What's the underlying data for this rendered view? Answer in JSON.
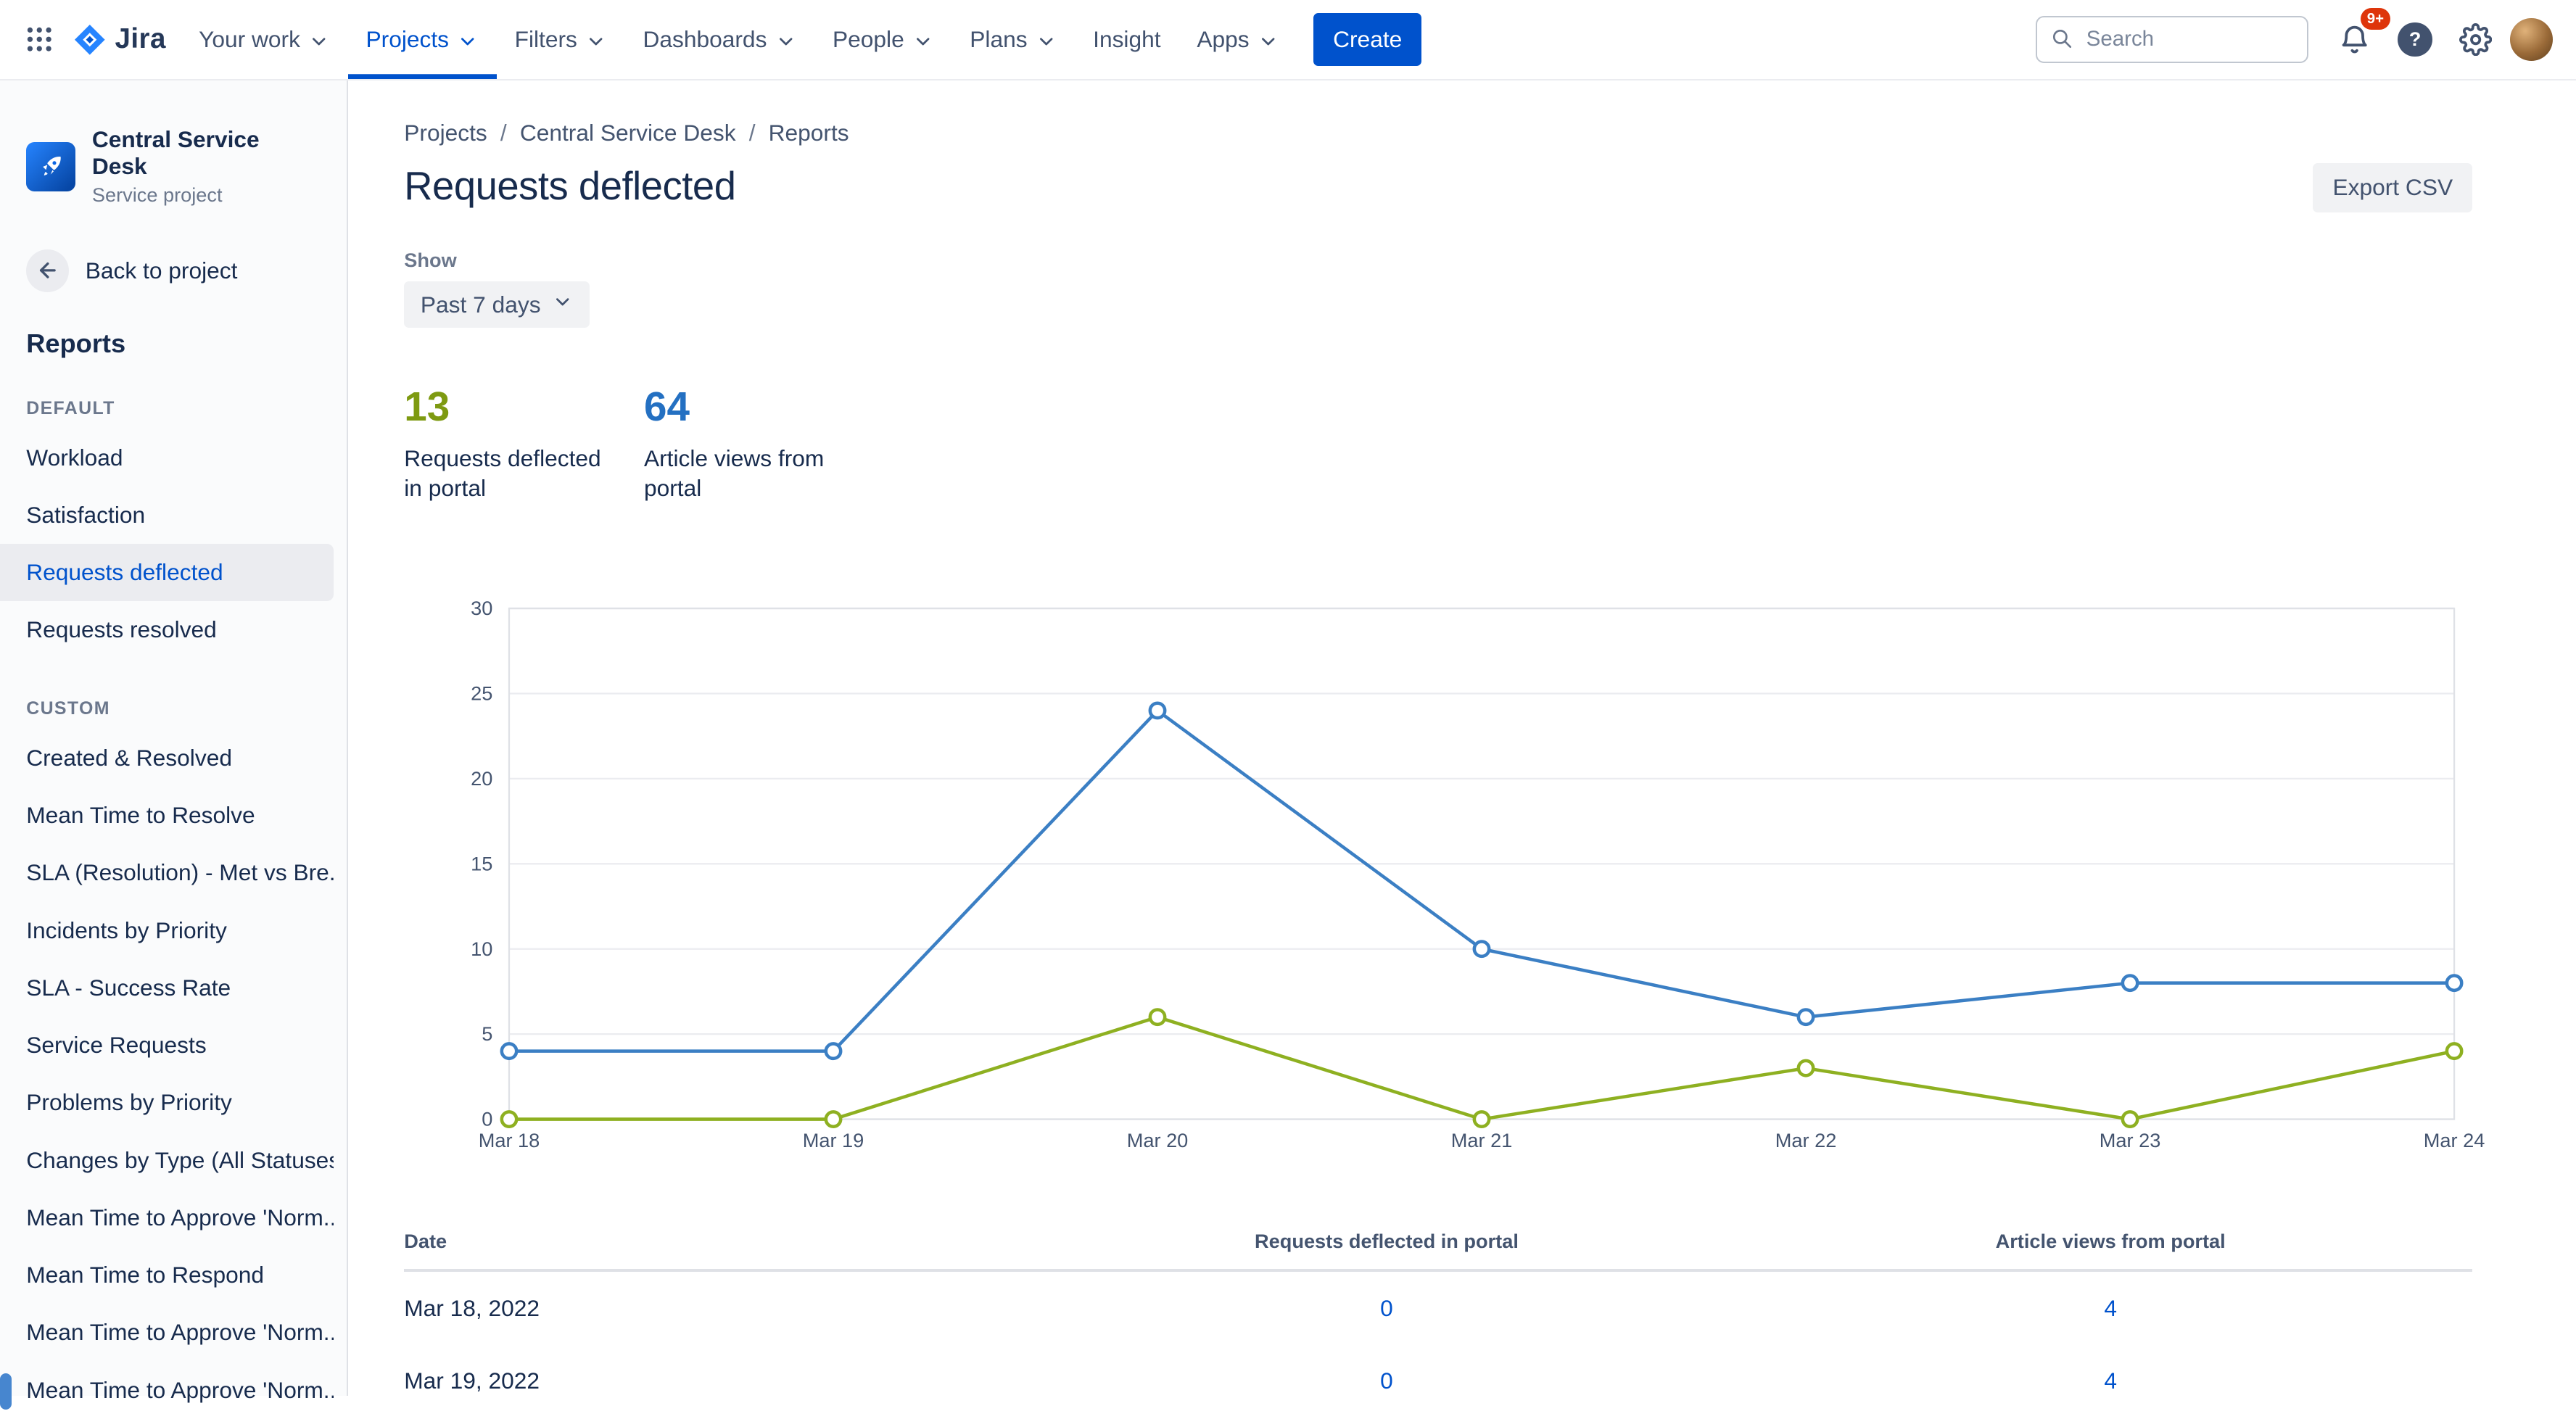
{
  "colors": {
    "accent": "#0052CC",
    "badge_red": "#DE350B",
    "selected_bg": "#EBECF0",
    "chart_blue": "#3b7fc4",
    "chart_green": "#8eb021"
  },
  "icons": {
    "help": "?",
    "breadcrumb_separator": "/"
  },
  "navbar": {
    "logo_text": "Jira",
    "items": [
      {
        "label": "Your work"
      },
      {
        "label": "Projects"
      },
      {
        "label": "Filters"
      },
      {
        "label": "Dashboards"
      },
      {
        "label": "People"
      },
      {
        "label": "Plans"
      },
      {
        "label": "Insight"
      },
      {
        "label": "Apps"
      }
    ],
    "active_item": "Projects",
    "create_label": "Create",
    "search_placeholder": "Search",
    "notifications_badge": "9+"
  },
  "sidebar": {
    "project": {
      "name": "Central Service Desk",
      "type": "Service project"
    },
    "back_label": "Back to project",
    "heading": "Reports",
    "selected_item": "Requests deflected",
    "groups": [
      {
        "label": "DEFAULT",
        "items": [
          "Workload",
          "Satisfaction",
          "Requests deflected",
          "Requests resolved"
        ]
      },
      {
        "label": "CUSTOM",
        "items": [
          "Created & Resolved",
          "Mean Time to Resolve",
          "SLA (Resolution) - Met vs Bre...",
          "Incidents by Priority",
          "SLA - Success Rate",
          "Service Requests",
          "Problems by Priority",
          "Changes by Type (All Statuses)",
          "Mean Time to Approve 'Norm...",
          "Mean Time to Respond",
          "Mean Time to Approve 'Norm...",
          "Mean Time to Approve 'Norm..."
        ]
      }
    ]
  },
  "main": {
    "breadcrumb": [
      "Projects",
      "Central Service Desk",
      "Reports"
    ],
    "breadcrumb_separator": "/",
    "title": "Requests deflected",
    "export_label": "Export CSV",
    "show_label": "Show",
    "period": "Past 7 days",
    "stats": [
      {
        "value": "13",
        "label": "Requests deflected in portal",
        "color": "#7e9a11"
      },
      {
        "value": "64",
        "label": "Article views from portal",
        "color": "#2470c2"
      }
    ]
  },
  "chart_data": {
    "type": "line",
    "title": "",
    "xlabel": "",
    "ylabel": "",
    "x": [
      "Mar 18",
      "Mar 19",
      "Mar 20",
      "Mar 21",
      "Mar 22",
      "Mar 23",
      "Mar 24"
    ],
    "series": [
      {
        "name": "Article views from portal",
        "color": "#3b7fc4",
        "values": [
          4,
          4,
          24,
          10,
          6,
          8,
          8
        ]
      },
      {
        "name": "Requests deflected in portal",
        "color": "#8eb021",
        "values": [
          0,
          0,
          6,
          0,
          3,
          0,
          4
        ]
      }
    ],
    "ylim": [
      0,
      30
    ],
    "yticks": [
      0,
      5,
      10,
      15,
      20,
      25,
      30
    ],
    "grid": true,
    "legend": "none"
  },
  "table": {
    "columns": [
      "Date",
      "Requests deflected in portal",
      "Article views from portal"
    ],
    "rows": [
      {
        "date": "Mar 18, 2022",
        "deflected": "0",
        "views": "4"
      },
      {
        "date": "Mar 19, 2022",
        "deflected": "0",
        "views": "4"
      }
    ]
  }
}
